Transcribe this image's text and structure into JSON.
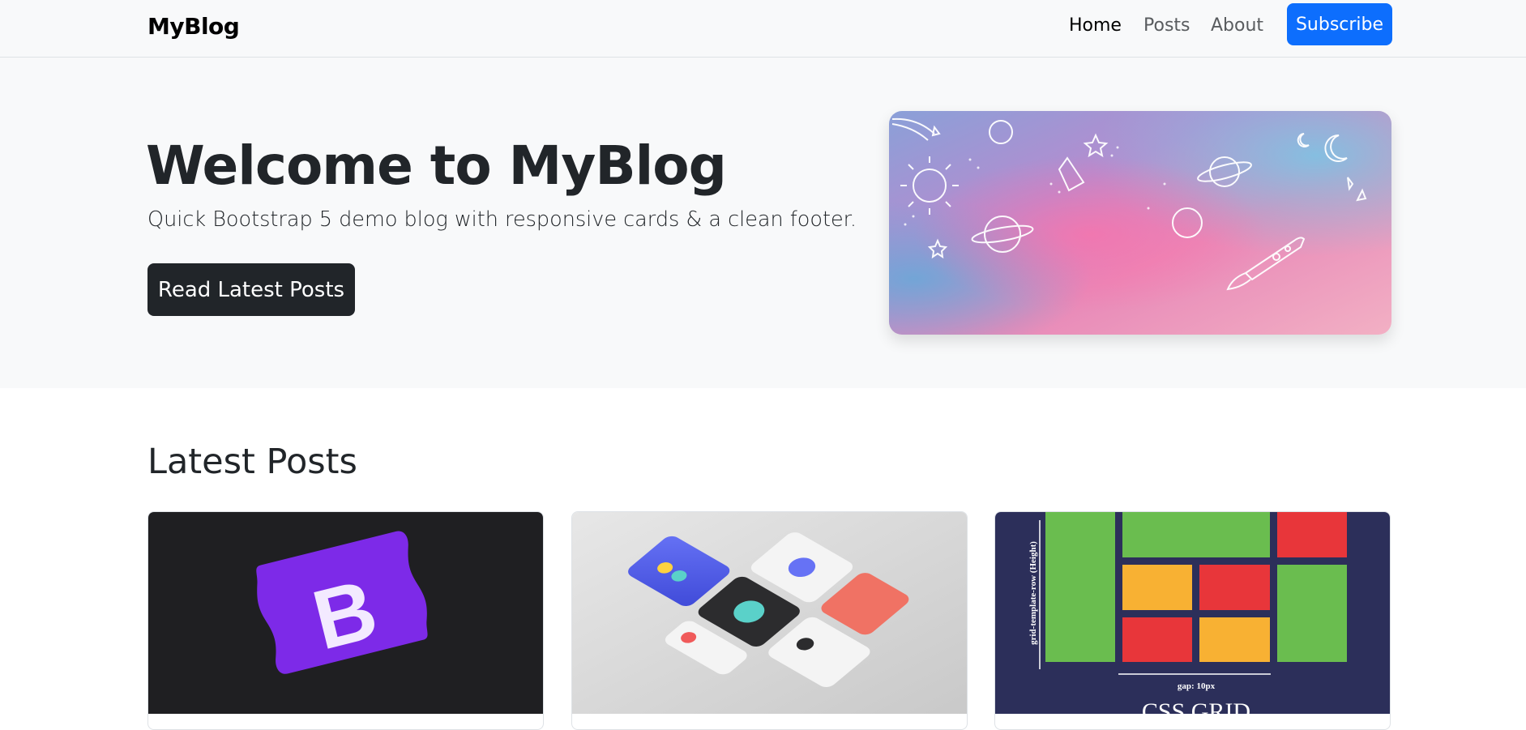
{
  "navbar": {
    "brand": "MyBlog",
    "links": [
      {
        "label": "Home",
        "active": true
      },
      {
        "label": "Posts",
        "active": false
      },
      {
        "label": "About",
        "active": false
      }
    ],
    "subscribe_label": "Subscribe"
  },
  "hero": {
    "title": "Welcome to MyBlog",
    "subtitle": "Quick Bootstrap 5 demo blog with responsive cards & a clean footer.",
    "button_label": "Read Latest Posts",
    "image_icon": "sky-doodle-illustration"
  },
  "latest": {
    "title": "Latest Posts",
    "cards": [
      {
        "image_icon": "bootstrap-logo",
        "image_text": "B"
      },
      {
        "image_icon": "ui-cards-illustration"
      },
      {
        "image_icon": "css-grid-diagram",
        "image_text_vertical": "grid-template-row (Height)",
        "image_text_gap": "gap: 10px",
        "image_text_title": "CSS GRID"
      }
    ]
  },
  "colors": {
    "primary": "#0d6efd",
    "dark": "#212529",
    "light": "#f8f9fa",
    "bootstrap_purple": "#7d2ae8"
  }
}
